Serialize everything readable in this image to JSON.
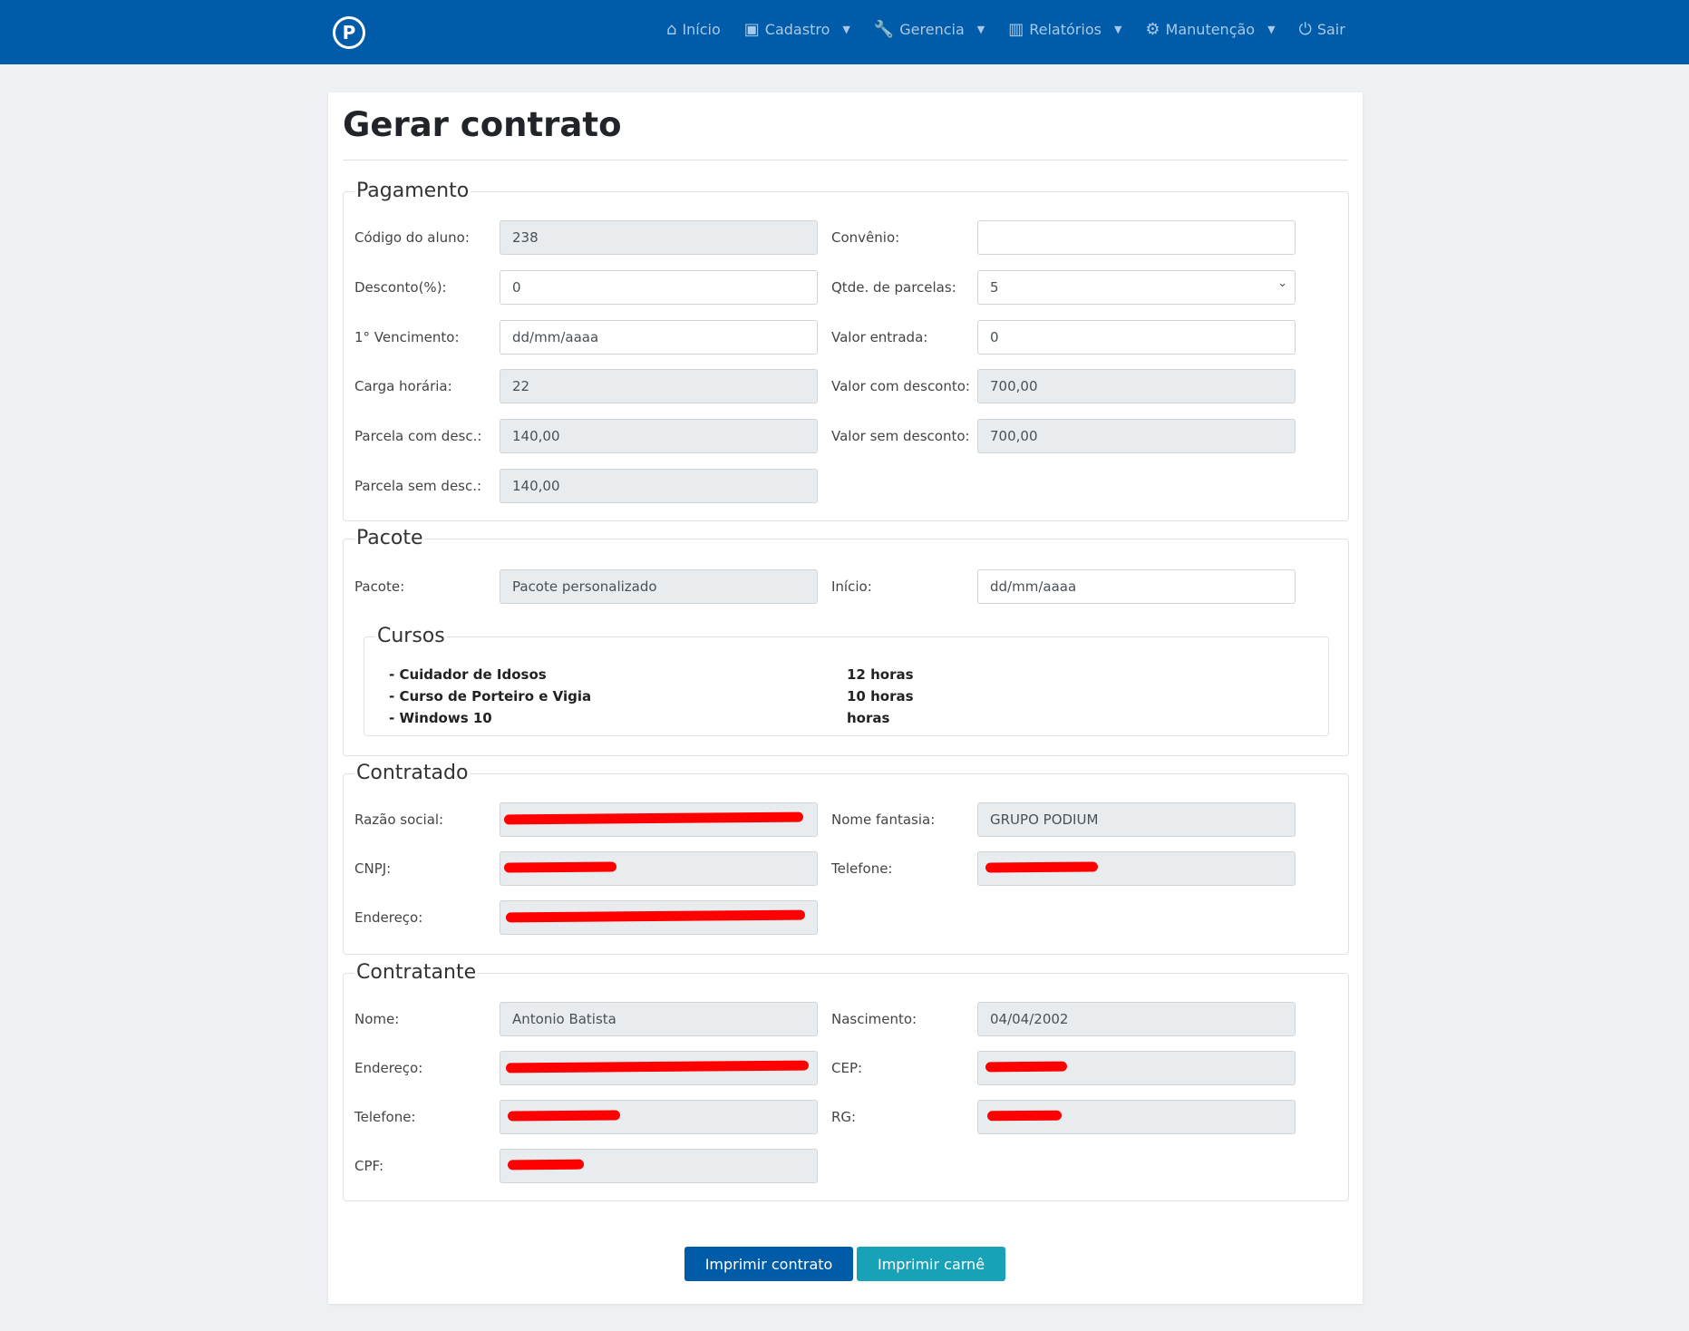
{
  "nav": {
    "logo": "P",
    "items": [
      {
        "label": "Início",
        "icon": "home-icon",
        "glyph": "⌂",
        "caret": false
      },
      {
        "label": "Cadastro",
        "icon": "id-badge-icon",
        "glyph": "▣",
        "caret": true
      },
      {
        "label": "Gerencia",
        "icon": "wrench-icon",
        "glyph": "🔧",
        "caret": true
      },
      {
        "label": "Relatórios",
        "icon": "chart-icon",
        "glyph": "▥",
        "caret": true
      },
      {
        "label": "Manutenção",
        "icon": "gear-icon",
        "glyph": "⚙",
        "caret": true
      },
      {
        "label": "Sair",
        "icon": "power-icon",
        "glyph": "⏻",
        "caret": false
      }
    ]
  },
  "title": "Gerar contrato",
  "pagamento": {
    "legend": "Pagamento",
    "codigo_label": "Código do aluno:",
    "codigo": "238",
    "convenio_label": "Convênio:",
    "convenio": "",
    "desconto_label": "Desconto(%):",
    "desconto": "0",
    "parcelas_label": "Qtde. de parcelas:",
    "parcelas": "5",
    "venc_label": "1° Vencimento:",
    "venc": "dd/mm/aaaa",
    "entrada_label": "Valor entrada:",
    "entrada": "0",
    "carga_label": "Carga horária:",
    "carga": "22",
    "vcd_label": "Valor com desconto:",
    "vcd": "700,00",
    "pcd_label": "Parcela com desc.:",
    "pcd": "140,00",
    "vsd_label": "Valor sem desconto:",
    "vsd": "700,00",
    "psd_label": "Parcela sem desc.:",
    "psd": "140,00"
  },
  "pacote": {
    "legend": "Pacote",
    "pacote_label": "Pacote:",
    "pacote": "Pacote personalizado",
    "inicio_label": "Início:",
    "inicio": "dd/mm/aaaa",
    "cursos_legend": "Cursos",
    "cursos": [
      {
        "name": "- Cuidador de Idosos",
        "hours": "12 horas"
      },
      {
        "name": "- Curso de Porteiro e Vigia",
        "hours": "10 horas"
      },
      {
        "name": "- Windows 10",
        "hours": "horas"
      }
    ]
  },
  "contratado": {
    "legend": "Contratado",
    "razao_label": "Razão social:",
    "fantasia_label": "Nome fantasia:",
    "fantasia": "GRUPO PODIUM",
    "cnpj_label": "CNPJ:",
    "telefone_label": "Telefone:",
    "endereco_label": "Endereço:"
  },
  "contratante": {
    "legend": "Contratante",
    "nome_label": "Nome:",
    "nome": "Antonio Batista",
    "nasc_label": "Nascimento:",
    "nasc": "04/04/2002",
    "endereco_label": "Endereço:",
    "cep_label": "CEP:",
    "telefone_label": "Telefone:",
    "rg_label": "RG:",
    "cpf_label": "CPF:"
  },
  "buttons": {
    "contrato": "Imprimir contrato",
    "carne": "Imprimir carnê"
  },
  "colors": {
    "navbar": "#005ca8",
    "primary": "#005ca8",
    "info": "#17a2b8",
    "redaction": "#ff0000"
  }
}
